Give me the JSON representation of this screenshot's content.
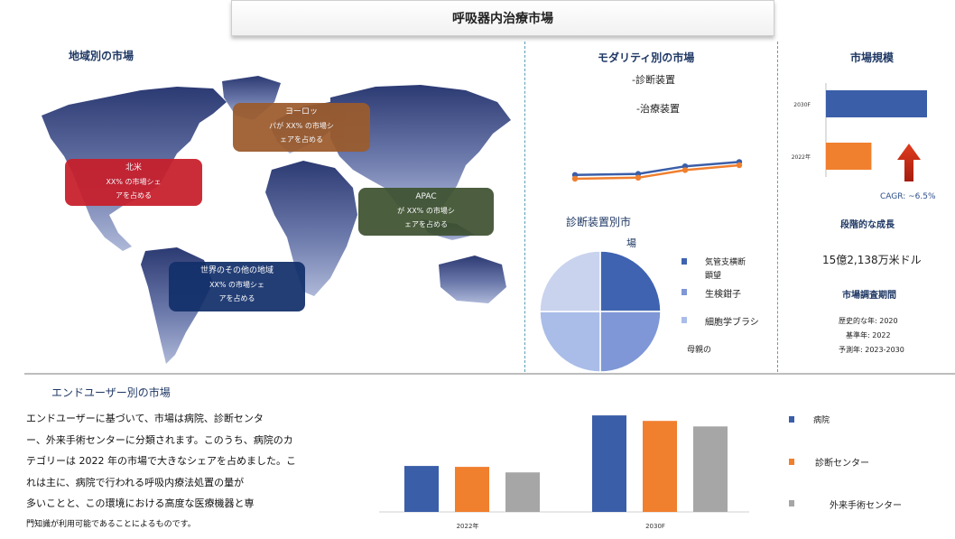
{
  "title": "呼吸器内治療市場",
  "region": {
    "heading": "地域別の市場",
    "callouts": {
      "europe": {
        "name": "ヨーロッ",
        "line1": "パが XX% の市場シ",
        "line2": "ェアを占める"
      },
      "north_america": {
        "name": "北米",
        "line1": "XX% の市場シェ",
        "line2": "アを占める"
      },
      "apac": {
        "name": "APAC",
        "line1": "が XX% の市場シ",
        "line2": "ェアを占める"
      },
      "row": {
        "name": "世界のその他の地域",
        "line1": "XX% の市場シェ",
        "line2": "アを占める"
      }
    }
  },
  "modality": {
    "heading": "モダリティ別の市場",
    "item1": "-診断装置",
    "item2": "-治療装置"
  },
  "diagnostic": {
    "heading_line1": "診断装置別市",
    "heading_line2": "場",
    "legend": [
      {
        "label": "気管支横断",
        "color": "#3f63b0"
      },
      {
        "label": "顕望",
        "color": "#3f63b0"
      },
      {
        "label": "生検鉗子",
        "color": "#7f97d6"
      },
      {
        "label": "細胞学ブラシ",
        "color": "#a9bde8"
      },
      {
        "label": "母親の",
        "color": "#c9d3ee"
      }
    ]
  },
  "market_size": {
    "heading": "市場規模",
    "cagr": "CAGR: ~6.5%",
    "growth_heading": "段階的な成長",
    "value": "15億2,138万米ドル",
    "period_heading": "市場調査期間",
    "historical": "歴史的な年: 2020",
    "base": "基準年: 2022",
    "forecast": "予測年: 2023-2030"
  },
  "end_user": {
    "heading": "エンドユーザー別の市場",
    "paragraph": [
      "エンドユーザーに基づいて、市場は病院、診断センタ",
      "ー、外来手術センターに分類されます。このうち、病院のカ",
      "テゴリーは 2022 年の市場で大きなシェアを占めました。こ",
      "れは主に、病院で行われる呼吸内療法処置の量が",
      "多いことと、この環境における高度な医療機器と専",
      "門知識が利用可能であることによるものです。"
    ]
  },
  "chart_data": [
    {
      "type": "bar",
      "orientation": "horizontal",
      "categories": [
        "2030F",
        "2022年"
      ],
      "values": [
        100,
        45
      ],
      "colors": [
        "#3a5ea8",
        "#f07f2e"
      ],
      "xlim": [
        0,
        100
      ]
    },
    {
      "type": "line",
      "x": [
        1,
        2,
        3,
        4
      ],
      "series": [
        {
          "values": [
            52,
            54,
            68,
            76
          ],
          "color": "#3a5ea8"
        },
        {
          "values": [
            45,
            47,
            61,
            70
          ],
          "color": "#f07f2e"
        }
      ],
      "ylim": [
        0,
        100
      ]
    },
    {
      "type": "pie",
      "labels": [
        "気管支横断顕望",
        "生検鉗子",
        "細胞学ブラシ",
        "母親の"
      ],
      "values": [
        25,
        25,
        25,
        25
      ],
      "colors": [
        "#3f63b0",
        "#7f97d6",
        "#a9bde8",
        "#c9d3ee"
      ]
    },
    {
      "type": "bar",
      "categories": [
        "2022年",
        "2030F"
      ],
      "series": [
        {
          "name": "病院",
          "values": [
            50,
            105
          ],
          "color": "#3a5ea8"
        },
        {
          "name": "診断センター",
          "values": [
            49,
            99
          ],
          "color": "#f07f2e"
        },
        {
          "name": "外来手術センター",
          "values": [
            43,
            93
          ],
          "color": "#a6a6a6"
        }
      ],
      "ylim": [
        0,
        110
      ]
    }
  ]
}
